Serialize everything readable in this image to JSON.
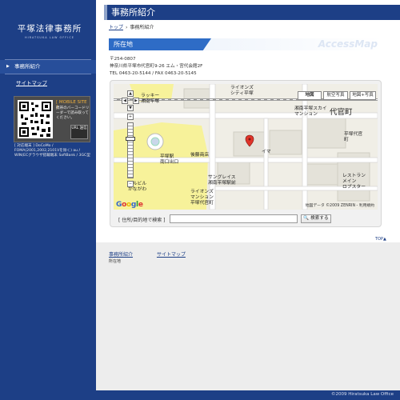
{
  "sidebar": {
    "logo_jp": "平塚法律事務所",
    "logo_en": "HIRATSUKA LAW OFFICE",
    "nav": [
      {
        "label": "事務所紹介",
        "active": true
      }
    ],
    "sitemap_label": "サイトマップ",
    "mobile": {
      "title": "[ MOBILE SITE ]",
      "description": "携帯のバーコードリーダーで読み取ってください。",
      "url_button": "URL 送信",
      "note": "[ 対応端末 ] DoCoMo / FOMA(2001,2002,2101Vを除く) au / WIN(ECグラウザ搭載端末 SoftBank / 3GC型"
    }
  },
  "header": {
    "title": "事務所紹介"
  },
  "breadcrumb": {
    "home": "トップ",
    "current": "事務所紹介"
  },
  "section": {
    "title": "所在地",
    "watermark": "AccessMap"
  },
  "address": {
    "postal": "〒254-0807",
    "street": "神奈川県平塚市代官町9-26 エム・宮代会館2F",
    "phone": "TEL 0463-20-5144 / FAX 0463-20-5145"
  },
  "map": {
    "type_buttons": [
      "地図",
      "航空写真",
      "地図+写真"
    ],
    "labels": {
      "lions_city": "ライオンズ\nシティ平塚",
      "lucky": "ラッキー\n湘南平塚",
      "shonan_sky": "湘南平塚スカイ\nマンション",
      "daikancho": "代官町",
      "hiratsuka_daikan": "平塚代官\n町",
      "station": "平塚駅\n南口出口",
      "gotoshoten": "後藤商店",
      "sunglace": "サングレイス\n湘南平塚駅前",
      "lions_mansion": "ライオンズ\nマンション\n平塚代官町",
      "restaurant": "レストラン\nメイン\nロプスター",
      "tamabil": "玉ルビル\nかながわ",
      "ima": "イマ"
    },
    "credit": "地図データ ©2009 ZENRIN - 利用規約",
    "google": "Google",
    "search_label": "[ 住所/目的地で検索 ]",
    "search_value": "",
    "search_button": "検索する"
  },
  "top_link": "TOP▲",
  "footer": {
    "links": [
      "事務所紹介",
      "サイトマップ"
    ],
    "sub": "所在地",
    "copyright": "©2009 Hiratsuka Law Office"
  },
  "colors": {
    "navy": "#1d3f86",
    "accent_blue": "#2e6cc6",
    "mobile_title": "#f2b23c"
  }
}
